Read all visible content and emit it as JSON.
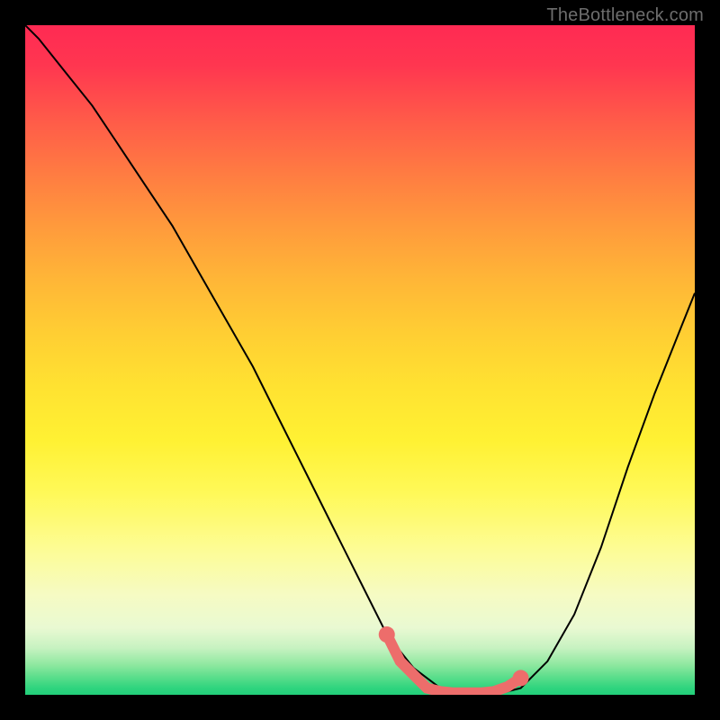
{
  "watermark": "TheBottleneck.com",
  "plot": {
    "x_range": [
      0,
      100
    ],
    "y_range": [
      0,
      100
    ],
    "marker_color": "#ed6d6b",
    "marker_stroke_width": 12,
    "marker_dot_radius": 9
  },
  "chart_data": {
    "type": "line",
    "title": "",
    "xlabel": "",
    "ylabel": "",
    "xlim": [
      0,
      100
    ],
    "ylim": [
      0,
      100
    ],
    "series": [
      {
        "name": "curve",
        "x": [
          0,
          2,
          6,
          10,
          14,
          18,
          22,
          26,
          30,
          34,
          38,
          42,
          46,
          50,
          54,
          58,
          62,
          66,
          70,
          74,
          78,
          82,
          86,
          90,
          94,
          98,
          100
        ],
        "values": [
          100,
          98,
          93,
          88,
          82,
          76,
          70,
          63,
          56,
          49,
          41,
          33,
          25,
          17,
          9,
          4,
          1,
          0,
          0,
          1,
          5,
          12,
          22,
          34,
          45,
          55,
          60
        ]
      },
      {
        "name": "highlight-segment",
        "x": [
          54,
          56,
          58,
          60,
          62,
          64,
          66,
          68,
          70,
          72,
          74
        ],
        "values": [
          9,
          5,
          3,
          1,
          0.5,
          0.3,
          0.3,
          0.3,
          0.5,
          1.2,
          2.5
        ]
      }
    ],
    "markers": [
      {
        "name": "dot-left",
        "x": 54,
        "y": 9
      },
      {
        "name": "dot-right",
        "x": 74,
        "y": 2.5
      }
    ]
  }
}
